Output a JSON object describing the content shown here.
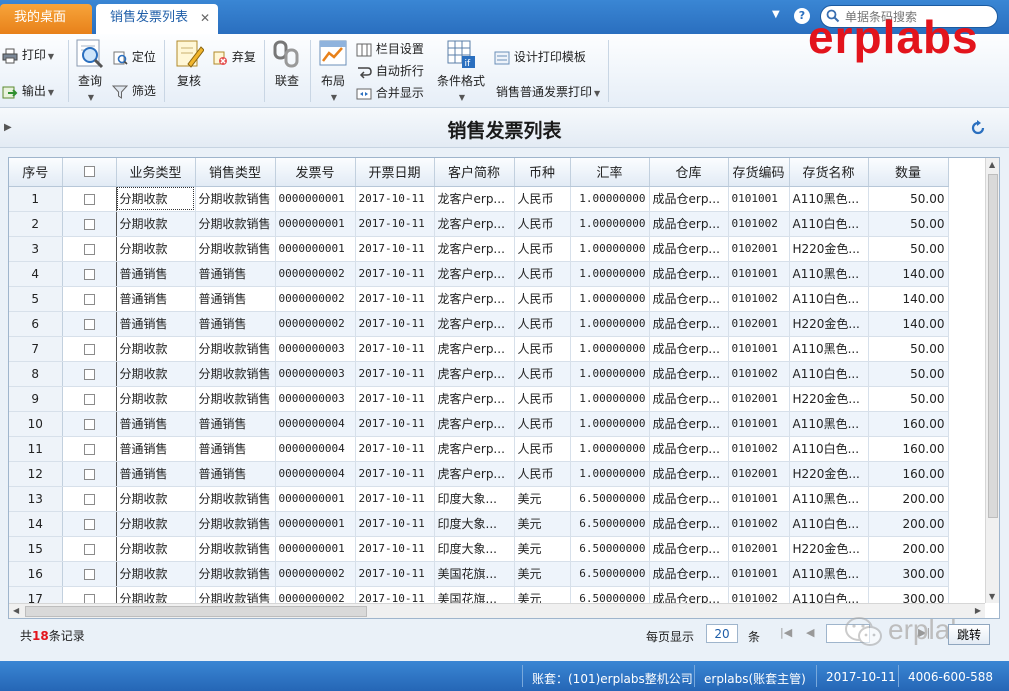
{
  "tabs": {
    "desktop": "我的桌面",
    "active": "销售发票列表",
    "close": "✕"
  },
  "search": {
    "placeholder": "单据条码搜索"
  },
  "brand": "erplabs",
  "toolbar": {
    "print": "打印",
    "export": "输出",
    "query": "查询",
    "locate": "定位",
    "filter": "筛选",
    "review": "复核",
    "abandon": "弃复",
    "link_query": "联查",
    "layout": "布局",
    "column_settings": "栏目设置",
    "auto_wrap": "自动折行",
    "merge_display": "合并显示",
    "conditional_format": "条件格式",
    "design_print_template": "设计打印模板",
    "print_normal_invoice": "销售普通发票打印"
  },
  "page_title": "销售发票列表",
  "table": {
    "headers": [
      "序号",
      "",
      "业务类型",
      "销售类型",
      "发票号",
      "开票日期",
      "客户简称",
      "币种",
      "汇率",
      "仓库",
      "存货编码",
      "存货名称",
      "数量"
    ],
    "rows": [
      [
        "1",
        "分期收款",
        "分期收款销售",
        "0000000001",
        "2017-10-11",
        "龙客户erp...",
        "人民币",
        "1.00000000",
        "成品仓erp...",
        "0101001",
        "A110黑色...",
        "50.00"
      ],
      [
        "2",
        "分期收款",
        "分期收款销售",
        "0000000001",
        "2017-10-11",
        "龙客户erp...",
        "人民币",
        "1.00000000",
        "成品仓erp...",
        "0101002",
        "A110白色...",
        "50.00"
      ],
      [
        "3",
        "分期收款",
        "分期收款销售",
        "0000000001",
        "2017-10-11",
        "龙客户erp...",
        "人民币",
        "1.00000000",
        "成品仓erp...",
        "0102001",
        "H220金色...",
        "50.00"
      ],
      [
        "4",
        "普通销售",
        "普通销售",
        "0000000002",
        "2017-10-11",
        "龙客户erp...",
        "人民币",
        "1.00000000",
        "成品仓erp...",
        "0101001",
        "A110黑色...",
        "140.00"
      ],
      [
        "5",
        "普通销售",
        "普通销售",
        "0000000002",
        "2017-10-11",
        "龙客户erp...",
        "人民币",
        "1.00000000",
        "成品仓erp...",
        "0101002",
        "A110白色...",
        "140.00"
      ],
      [
        "6",
        "普通销售",
        "普通销售",
        "0000000002",
        "2017-10-11",
        "龙客户erp...",
        "人民币",
        "1.00000000",
        "成品仓erp...",
        "0102001",
        "H220金色...",
        "140.00"
      ],
      [
        "7",
        "分期收款",
        "分期收款销售",
        "0000000003",
        "2017-10-11",
        "虎客户erp...",
        "人民币",
        "1.00000000",
        "成品仓erp...",
        "0101001",
        "A110黑色...",
        "50.00"
      ],
      [
        "8",
        "分期收款",
        "分期收款销售",
        "0000000003",
        "2017-10-11",
        "虎客户erp...",
        "人民币",
        "1.00000000",
        "成品仓erp...",
        "0101002",
        "A110白色...",
        "50.00"
      ],
      [
        "9",
        "分期收款",
        "分期收款销售",
        "0000000003",
        "2017-10-11",
        "虎客户erp...",
        "人民币",
        "1.00000000",
        "成品仓erp...",
        "0102001",
        "H220金色...",
        "50.00"
      ],
      [
        "10",
        "普通销售",
        "普通销售",
        "0000000004",
        "2017-10-11",
        "虎客户erp...",
        "人民币",
        "1.00000000",
        "成品仓erp...",
        "0101001",
        "A110黑色...",
        "160.00"
      ],
      [
        "11",
        "普通销售",
        "普通销售",
        "0000000004",
        "2017-10-11",
        "虎客户erp...",
        "人民币",
        "1.00000000",
        "成品仓erp...",
        "0101002",
        "A110白色...",
        "160.00"
      ],
      [
        "12",
        "普通销售",
        "普通销售",
        "0000000004",
        "2017-10-11",
        "虎客户erp...",
        "人民币",
        "1.00000000",
        "成品仓erp...",
        "0102001",
        "H220金色...",
        "160.00"
      ],
      [
        "13",
        "分期收款",
        "分期收款销售",
        "0000000001",
        "2017-10-11",
        "印度大象...",
        "美元",
        "6.50000000",
        "成品仓erp...",
        "0101001",
        "A110黑色...",
        "200.00"
      ],
      [
        "14",
        "分期收款",
        "分期收款销售",
        "0000000001",
        "2017-10-11",
        "印度大象...",
        "美元",
        "6.50000000",
        "成品仓erp...",
        "0101002",
        "A110白色...",
        "200.00"
      ],
      [
        "15",
        "分期收款",
        "分期收款销售",
        "0000000001",
        "2017-10-11",
        "印度大象...",
        "美元",
        "6.50000000",
        "成品仓erp...",
        "0102001",
        "H220金色...",
        "200.00"
      ],
      [
        "16",
        "分期收款",
        "分期收款销售",
        "0000000002",
        "2017-10-11",
        "美国花旗...",
        "美元",
        "6.50000000",
        "成品仓erp...",
        "0101001",
        "A110黑色...",
        "300.00"
      ],
      [
        "17",
        "分期收款",
        "分期收款销售",
        "0000000002",
        "2017-10-11",
        "美国花旗...",
        "美元",
        "6.50000000",
        "成品仓erp...",
        "0101002",
        "A110白色...",
        "300.00"
      ]
    ]
  },
  "pager": {
    "record_prefix": "共",
    "record_count": "18",
    "record_suffix": "条记录",
    "per_page_label": "每页显示",
    "per_page_value": "20",
    "per_page_unit": "条",
    "jump": "跳转"
  },
  "watermark": "erplabs",
  "status": {
    "account": "账套：(101)erplabs整机公司",
    "user": "erplabs(账套主管)",
    "date": "2017-10-11",
    "phone": "4006-600-588"
  },
  "colors": {
    "accent": "#2a6fbf",
    "desktop_tab": "#e8811a",
    "brand": "#e3141c"
  }
}
